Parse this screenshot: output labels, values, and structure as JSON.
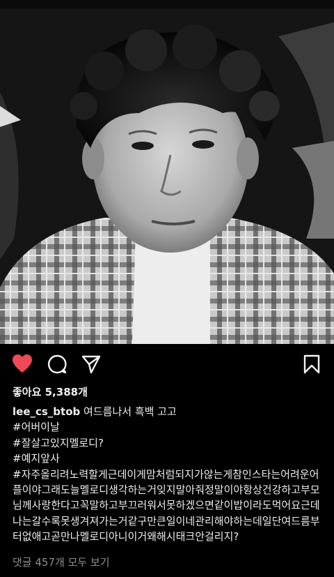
{
  "post": {
    "likes_text": "좋아요 5,388개",
    "username": "lee_cs_btob",
    "caption_first": "여드름나서 흑백 고고",
    "hashtags": [
      "#어버이날",
      "#잘살고있지멜로디?",
      "#예지앞사"
    ],
    "long_hashtag": "#자주올리려노력할게근데이게맘처럼되지가않는게참인스타는어려운어플이야그래도늘멜로디생각하는거잊지말아줘정말이야항상건강하고부모님께사랑한다고꼭말하고부끄러워서못하겠으면같이밥이라도먹어요근데나는갈수록못생겨져가는거같구만큰일이네관리해야하는데일단여드름부터없애고곧만나멜로디아니이거왜해시태크안걸리지?",
    "view_comments": "댓글 457개 모두 보기"
  },
  "actions": {
    "like_icon": "heart-filled-icon",
    "comment_icon": "speech-bubble-icon",
    "share_icon": "paper-plane-icon",
    "save_icon": "bookmark-icon",
    "like_color": "#ed4956"
  }
}
